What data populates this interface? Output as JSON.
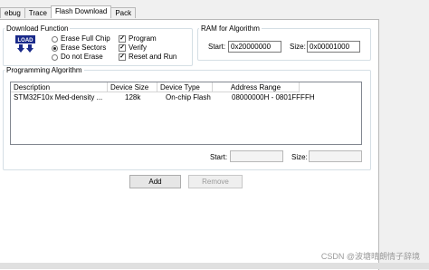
{
  "tabs": [
    {
      "label": "ebug"
    },
    {
      "label": "Trace"
    },
    {
      "label": "Flash Download"
    },
    {
      "label": "Pack"
    }
  ],
  "download_function": {
    "title": "Download Function",
    "radios": [
      {
        "label": "Erase Full Chip",
        "checked": false
      },
      {
        "label": "Erase Sectors",
        "checked": true
      },
      {
        "label": "Do not Erase",
        "checked": false
      }
    ],
    "checks": [
      {
        "label": "Program",
        "checked": true
      },
      {
        "label": "Verify",
        "checked": true
      },
      {
        "label": "Reset and Run",
        "checked": true
      }
    ]
  },
  "ram": {
    "title": "RAM for Algorithm",
    "start_label": "Start:",
    "start_value": "0x20000000",
    "size_label": "Size:",
    "size_value": "0x00001000"
  },
  "programming": {
    "title": "Programming Algorithm",
    "columns": [
      "Description",
      "Device Size",
      "Device Type",
      "Address Range"
    ],
    "rows": [
      {
        "description": "STM32F10x Med-density ...",
        "size": "128k",
        "type": "On-chip Flash",
        "range": "08000000H - 0801FFFFH"
      }
    ],
    "start_label": "Start:",
    "start_value": "",
    "size_label": "Size:",
    "size_value": ""
  },
  "buttons": {
    "add": "Add",
    "remove": "Remove"
  },
  "watermark": "CSDN @波塘晴朗情子辞境",
  "icon": {
    "name": "load-icon",
    "text": "LOAD"
  }
}
